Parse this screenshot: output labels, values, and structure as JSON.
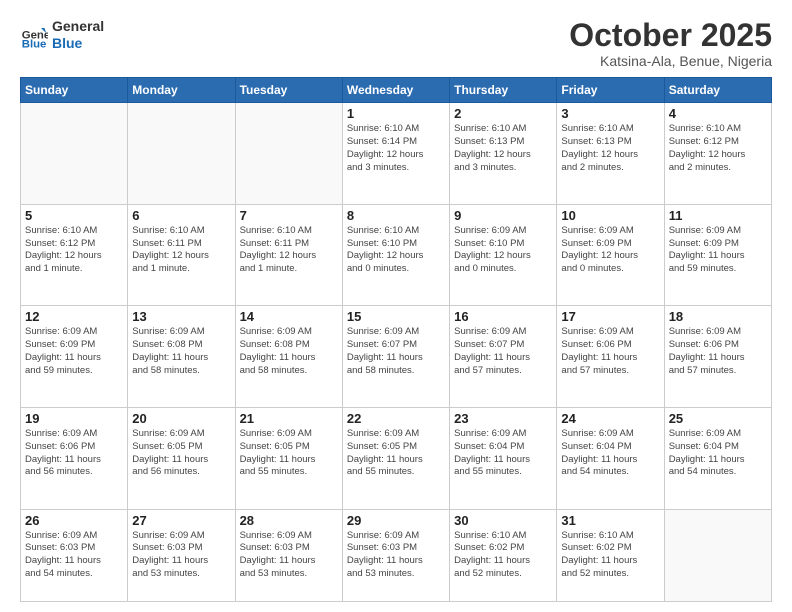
{
  "header": {
    "logo_line1": "General",
    "logo_line2": "Blue",
    "title": "October 2025",
    "subtitle": "Katsina-Ala, Benue, Nigeria"
  },
  "days_of_week": [
    "Sunday",
    "Monday",
    "Tuesday",
    "Wednesday",
    "Thursday",
    "Friday",
    "Saturday"
  ],
  "weeks": [
    [
      {
        "day": "",
        "info": ""
      },
      {
        "day": "",
        "info": ""
      },
      {
        "day": "",
        "info": ""
      },
      {
        "day": "1",
        "info": "Sunrise: 6:10 AM\nSunset: 6:14 PM\nDaylight: 12 hours\nand 3 minutes."
      },
      {
        "day": "2",
        "info": "Sunrise: 6:10 AM\nSunset: 6:13 PM\nDaylight: 12 hours\nand 3 minutes."
      },
      {
        "day": "3",
        "info": "Sunrise: 6:10 AM\nSunset: 6:13 PM\nDaylight: 12 hours\nand 2 minutes."
      },
      {
        "day": "4",
        "info": "Sunrise: 6:10 AM\nSunset: 6:12 PM\nDaylight: 12 hours\nand 2 minutes."
      }
    ],
    [
      {
        "day": "5",
        "info": "Sunrise: 6:10 AM\nSunset: 6:12 PM\nDaylight: 12 hours\nand 1 minute."
      },
      {
        "day": "6",
        "info": "Sunrise: 6:10 AM\nSunset: 6:11 PM\nDaylight: 12 hours\nand 1 minute."
      },
      {
        "day": "7",
        "info": "Sunrise: 6:10 AM\nSunset: 6:11 PM\nDaylight: 12 hours\nand 1 minute."
      },
      {
        "day": "8",
        "info": "Sunrise: 6:10 AM\nSunset: 6:10 PM\nDaylight: 12 hours\nand 0 minutes."
      },
      {
        "day": "9",
        "info": "Sunrise: 6:09 AM\nSunset: 6:10 PM\nDaylight: 12 hours\nand 0 minutes."
      },
      {
        "day": "10",
        "info": "Sunrise: 6:09 AM\nSunset: 6:09 PM\nDaylight: 12 hours\nand 0 minutes."
      },
      {
        "day": "11",
        "info": "Sunrise: 6:09 AM\nSunset: 6:09 PM\nDaylight: 11 hours\nand 59 minutes."
      }
    ],
    [
      {
        "day": "12",
        "info": "Sunrise: 6:09 AM\nSunset: 6:09 PM\nDaylight: 11 hours\nand 59 minutes."
      },
      {
        "day": "13",
        "info": "Sunrise: 6:09 AM\nSunset: 6:08 PM\nDaylight: 11 hours\nand 58 minutes."
      },
      {
        "day": "14",
        "info": "Sunrise: 6:09 AM\nSunset: 6:08 PM\nDaylight: 11 hours\nand 58 minutes."
      },
      {
        "day": "15",
        "info": "Sunrise: 6:09 AM\nSunset: 6:07 PM\nDaylight: 11 hours\nand 58 minutes."
      },
      {
        "day": "16",
        "info": "Sunrise: 6:09 AM\nSunset: 6:07 PM\nDaylight: 11 hours\nand 57 minutes."
      },
      {
        "day": "17",
        "info": "Sunrise: 6:09 AM\nSunset: 6:06 PM\nDaylight: 11 hours\nand 57 minutes."
      },
      {
        "day": "18",
        "info": "Sunrise: 6:09 AM\nSunset: 6:06 PM\nDaylight: 11 hours\nand 57 minutes."
      }
    ],
    [
      {
        "day": "19",
        "info": "Sunrise: 6:09 AM\nSunset: 6:06 PM\nDaylight: 11 hours\nand 56 minutes."
      },
      {
        "day": "20",
        "info": "Sunrise: 6:09 AM\nSunset: 6:05 PM\nDaylight: 11 hours\nand 56 minutes."
      },
      {
        "day": "21",
        "info": "Sunrise: 6:09 AM\nSunset: 6:05 PM\nDaylight: 11 hours\nand 55 minutes."
      },
      {
        "day": "22",
        "info": "Sunrise: 6:09 AM\nSunset: 6:05 PM\nDaylight: 11 hours\nand 55 minutes."
      },
      {
        "day": "23",
        "info": "Sunrise: 6:09 AM\nSunset: 6:04 PM\nDaylight: 11 hours\nand 55 minutes."
      },
      {
        "day": "24",
        "info": "Sunrise: 6:09 AM\nSunset: 6:04 PM\nDaylight: 11 hours\nand 54 minutes."
      },
      {
        "day": "25",
        "info": "Sunrise: 6:09 AM\nSunset: 6:04 PM\nDaylight: 11 hours\nand 54 minutes."
      }
    ],
    [
      {
        "day": "26",
        "info": "Sunrise: 6:09 AM\nSunset: 6:03 PM\nDaylight: 11 hours\nand 54 minutes."
      },
      {
        "day": "27",
        "info": "Sunrise: 6:09 AM\nSunset: 6:03 PM\nDaylight: 11 hours\nand 53 minutes."
      },
      {
        "day": "28",
        "info": "Sunrise: 6:09 AM\nSunset: 6:03 PM\nDaylight: 11 hours\nand 53 minutes."
      },
      {
        "day": "29",
        "info": "Sunrise: 6:09 AM\nSunset: 6:03 PM\nDaylight: 11 hours\nand 53 minutes."
      },
      {
        "day": "30",
        "info": "Sunrise: 6:10 AM\nSunset: 6:02 PM\nDaylight: 11 hours\nand 52 minutes."
      },
      {
        "day": "31",
        "info": "Sunrise: 6:10 AM\nSunset: 6:02 PM\nDaylight: 11 hours\nand 52 minutes."
      },
      {
        "day": "",
        "info": ""
      }
    ]
  ]
}
